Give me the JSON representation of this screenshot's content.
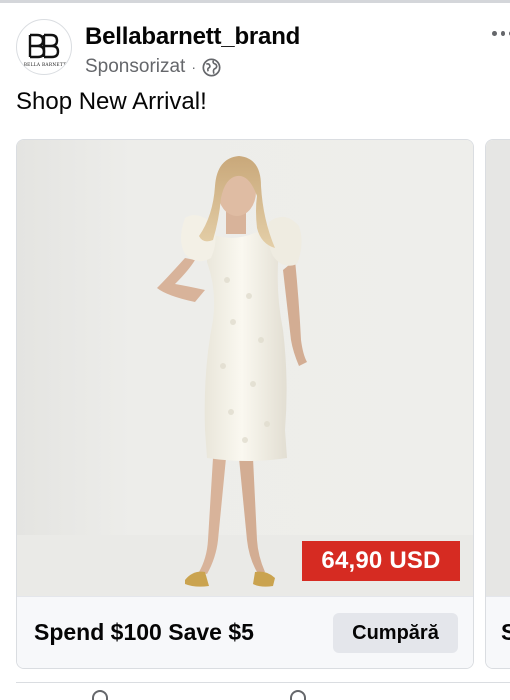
{
  "post": {
    "page_name": "Bellabarnett_brand",
    "sponsored_label": "Sponsorizat",
    "separator": "·",
    "message": "Shop New Arrival!",
    "avatar_monogram": "BB",
    "avatar_wordmark": "BELLA BARNETT",
    "audience_icon": "globe-icon",
    "menu_icon": "more-horizontal-icon"
  },
  "carousel": {
    "cards": [
      {
        "image": "woman-in-white-puff-sleeve-dress",
        "price": "64,90 USD",
        "headline": "Spend $100 Save $5",
        "cta": "Cumpără"
      },
      {
        "headline_peek": "S"
      }
    ]
  },
  "colors": {
    "price_tag": "#d62b22",
    "cta_bg": "#e4e6eb",
    "secondary_text": "#65676b",
    "footer_bg": "#f7f8fa"
  }
}
